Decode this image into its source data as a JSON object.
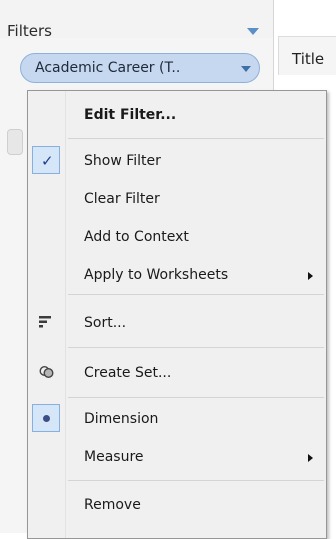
{
  "filters_panel": {
    "title": "Filters",
    "filter_pill": {
      "label": "Academic Career (T.."
    }
  },
  "title_area": {
    "label": "Title"
  },
  "context_menu": {
    "items": [
      {
        "label": "Edit Filter...",
        "bold": true
      },
      {
        "label": "Show Filter",
        "checked": true,
        "icon": "checkmark-icon"
      },
      {
        "label": "Clear Filter"
      },
      {
        "label": "Add to Context"
      },
      {
        "label": "Apply to Worksheets",
        "submenu": true
      },
      {
        "label": "Sort...",
        "icon": "sort-icon"
      },
      {
        "label": "Create Set...",
        "icon": "set-icon"
      },
      {
        "label": "Dimension",
        "selected": true,
        "icon": "dimension-icon"
      },
      {
        "label": "Measure",
        "submenu": true
      },
      {
        "label": "Remove"
      }
    ]
  },
  "colors": {
    "pill_fill": "#c6d8ef",
    "accent_blue": "#5b8fc7",
    "menu_bg": "#f0f0f0"
  }
}
